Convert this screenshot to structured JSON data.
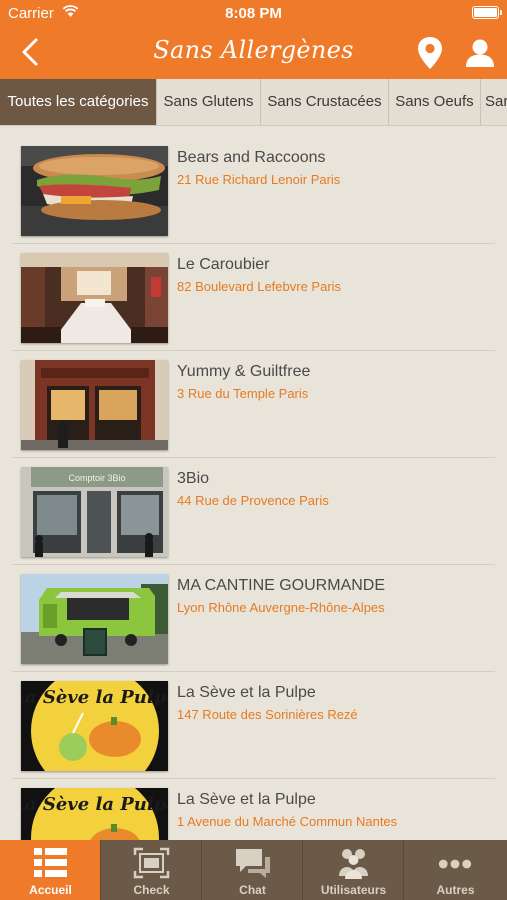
{
  "status_bar": {
    "carrier": "Carrier",
    "time": "8:08 PM"
  },
  "nav": {
    "title": "Sans Allergènes"
  },
  "categories": [
    {
      "label": "Toutes les catégories",
      "active": true
    },
    {
      "label": "Sans Glutens"
    },
    {
      "label": "Sans Crustacées"
    },
    {
      "label": "Sans Oeufs"
    },
    {
      "label": "Sar"
    }
  ],
  "restaurants": [
    {
      "name": "Bears and Raccoons",
      "address": "21 Rue Richard Lenoir Paris"
    },
    {
      "name": "Le Caroubier",
      "address": "82 Boulevard Lefebvre Paris"
    },
    {
      "name": "Yummy & Guiltfree",
      "address": "3 Rue du Temple Paris"
    },
    {
      "name": "3Bio",
      "address": "44 Rue de Provence Paris"
    },
    {
      "name": "MA CANTINE GOURMANDE",
      "address": "Lyon Rhône Auvergne-Rhône-Alpes"
    },
    {
      "name": "La Sève et la Pulpe",
      "address": "147 Route des Sorinières Rezé"
    },
    {
      "name": "La Sève et la Pulpe",
      "address": "1 Avenue du Marché Commun Nantes"
    }
  ],
  "thumb_text": {
    "pulpe_logo": "La Sève la Pulpe",
    "shop_sign_3bio": "Comptoir 3Bio"
  },
  "tabbar": [
    {
      "label": "Accueil",
      "icon": "list-icon",
      "active": true
    },
    {
      "label": "Check",
      "icon": "scan-icon"
    },
    {
      "label": "Chat",
      "icon": "chat-bubbles-icon"
    },
    {
      "label": "Utilisateurs",
      "icon": "users-icon"
    },
    {
      "label": "Autres",
      "icon": "more-dots-icon"
    }
  ],
  "colors": {
    "accent": "#ee7a2a",
    "tab_active_bg": "#6e5844",
    "tabbar_bg": "#6b5a48",
    "background": "#e9e4da",
    "address": "#e67a22"
  }
}
